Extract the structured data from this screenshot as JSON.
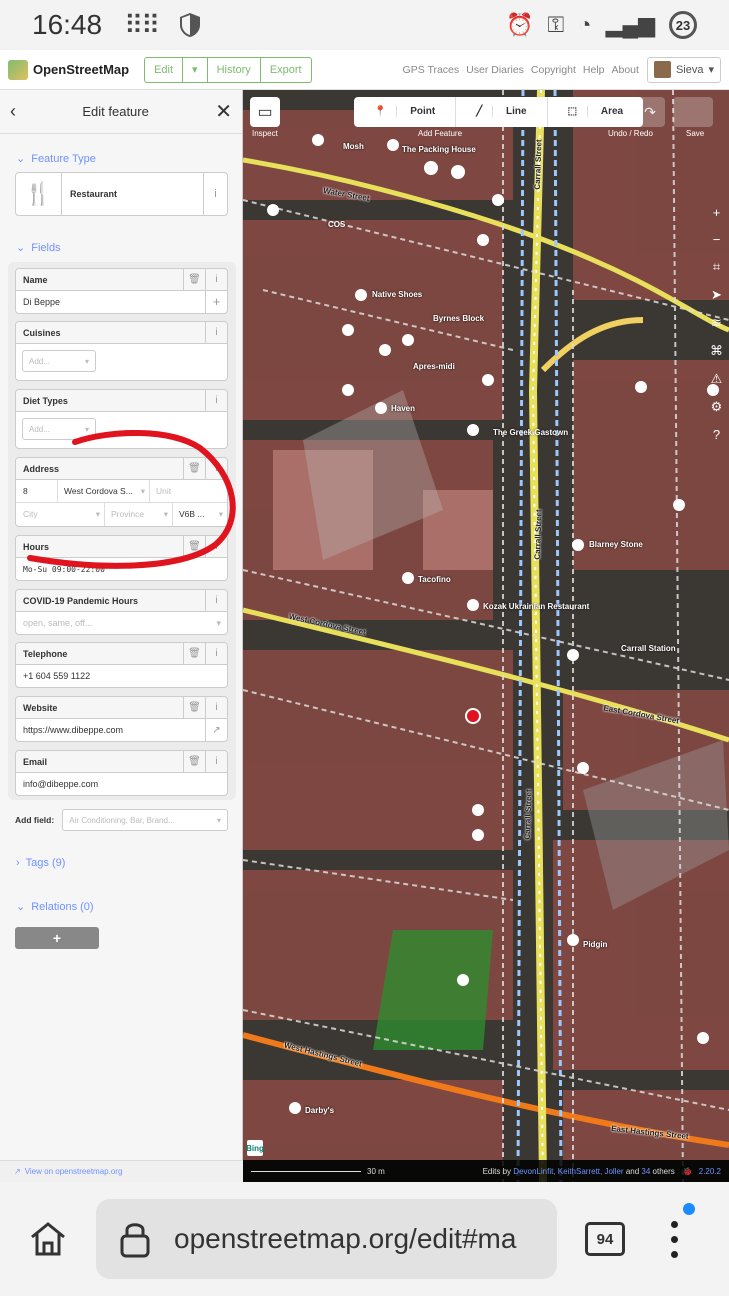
{
  "status": {
    "time": "16:48",
    "battery": "23"
  },
  "topbar": {
    "brand": "OpenStreetMap",
    "edit": "Edit",
    "history": "History",
    "export": "Export",
    "links": [
      "GPS Traces",
      "User Diaries",
      "Copyright",
      "Help",
      "About"
    ],
    "user": "Sieva"
  },
  "sidebar": {
    "title": "Edit feature",
    "feature_type_label": "Feature Type",
    "preset": "Restaurant",
    "fields_label": "Fields",
    "name_label": "Name",
    "name_value": "Di Beppe",
    "cuisines_label": "Cuisines",
    "cuisines_placeholder": "Add...",
    "diet_label": "Diet Types",
    "diet_placeholder": "Add...",
    "address_label": "Address",
    "addr_number": "8",
    "addr_street": "West Cordova S...",
    "addr_unit": "Unit",
    "addr_city": "City",
    "addr_province": "Province",
    "addr_postcode": "V6B ...",
    "hours_label": "Hours",
    "hours_value": "Mo-Su 09:00-22:00",
    "covid_label": "COVID-19 Pandemic Hours",
    "covid_placeholder": "open, same, off...",
    "telephone_label": "Telephone",
    "telephone_value": "+1 604 559 1122",
    "website_label": "Website",
    "website_value": "https://www.dibeppe.com",
    "email_label": "Email",
    "email_value": "info@dibeppe.com",
    "add_field_label": "Add field:",
    "add_field_placeholder": "Air Conditioning, Bar, Brand...",
    "tags_label": "Tags (9)",
    "relations_label": "Relations (0)",
    "add_relation": "+",
    "view_on": "View on openstreetmap.org"
  },
  "map": {
    "inspect": "Inspect",
    "point": "Point",
    "line": "Line",
    "area": "Area",
    "add_feature": "Add Feature",
    "undo_redo": "Undo / Redo",
    "save": "Save",
    "streets": [
      "Water Street",
      "West Cordova Street",
      "Carrall Street",
      "East Cordova Street",
      "West Hastings Street",
      "East Hastings Street"
    ],
    "pois": [
      "Mosh",
      "The Packing House",
      "COS",
      "Native Shoes",
      "Byrnes Block",
      "Apres-midi",
      "Haven",
      "The Greek Gastown",
      "Blarney Stone",
      "Tacofino",
      "Kozak Ukrainian Restaurant",
      "Carrall Station",
      "Pidgin",
      "Darby's"
    ],
    "scale": "30 m",
    "edits_by": "Edits by",
    "editors": "DevonLinfit, KeithSarrett, Joller",
    "and": "and",
    "others_count": "34",
    "others": "others",
    "version": "2.20.2",
    "bing": "Bing"
  },
  "browser": {
    "url": "openstreetmap.org/edit#ma",
    "tab_count": "94"
  },
  "colors": {
    "accent": "#7ebc6f",
    "link": "#7092ff",
    "annotation": "#e0141e"
  }
}
